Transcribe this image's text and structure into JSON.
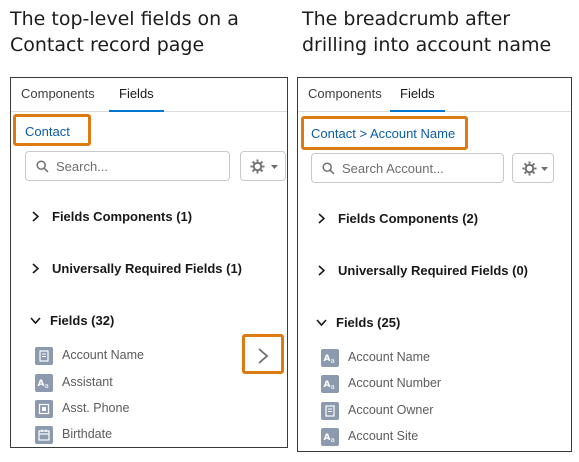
{
  "captions": {
    "left": "The top-level fields on a Contact record page",
    "right": "The breadcrumb after drilling into account name"
  },
  "left_panel": {
    "tabs": [
      {
        "label": "Components"
      },
      {
        "label": "Fields"
      }
    ],
    "breadcrumb": [
      "Contact"
    ],
    "search": {
      "placeholder": "Search..."
    },
    "sections": [
      {
        "label": "Fields Components (1)",
        "expanded": false
      },
      {
        "label": "Universally Required Fields (1)",
        "expanded": false
      },
      {
        "label": "Fields (32)",
        "expanded": true
      }
    ],
    "fields": [
      {
        "label": "Account Name",
        "icon": "lookup-icon"
      },
      {
        "label": "Assistant",
        "icon": "text-icon"
      },
      {
        "label": "Asst. Phone",
        "icon": "phone-icon"
      },
      {
        "label": "Birthdate",
        "icon": "date-icon"
      }
    ]
  },
  "right_panel": {
    "tabs": [
      {
        "label": "Components"
      },
      {
        "label": "Fields"
      }
    ],
    "breadcrumb": [
      "Contact",
      "Account Name"
    ],
    "breadcrumb_separator": ">",
    "search": {
      "placeholder": "Search Account..."
    },
    "sections": [
      {
        "label": "Fields Components (2)",
        "expanded": false
      },
      {
        "label": "Universally Required Fields (0)",
        "expanded": false
      },
      {
        "label": "Fields (25)",
        "expanded": true
      }
    ],
    "fields": [
      {
        "label": "Account Name",
        "icon": "text-icon"
      },
      {
        "label": "Account Number",
        "icon": "text-icon"
      },
      {
        "label": "Account Owner",
        "icon": "lookup-icon"
      },
      {
        "label": "Account Site",
        "icon": "text-icon"
      }
    ]
  },
  "colors": {
    "highlight": "#dd7a12",
    "link": "#0b5cab",
    "tab_active": "#0176d3",
    "icon_bg": "#8b9aae"
  }
}
